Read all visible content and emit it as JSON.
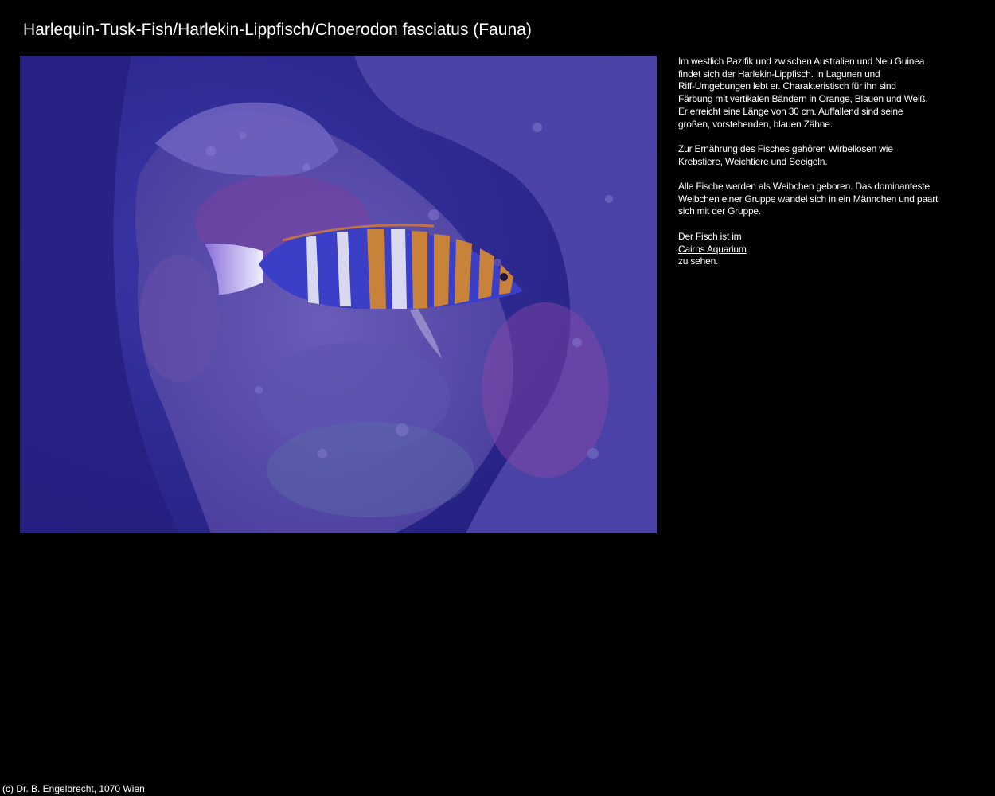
{
  "page": {
    "title": "Harlequin-Tusk-Fish/Harlekin-Lippfisch/Choerodon fasciatus (Fauna)"
  },
  "photo": {
    "subject": "fish-photo",
    "colors": {
      "water": "#2c2a8c",
      "rock": "#5a4fb0",
      "band_orange": "#c9823a",
      "band_blue": "#3b3fc8",
      "band_white": "#d8d8f0"
    }
  },
  "description": {
    "paragraph1": [
      "Im westlich Pazifik und zwischen Australien und Neu Guinea",
      "findet sich der Harlekin-Lippfisch. In Lagunen und",
      "Riff-Umgebungen lebt er. Charakteristisch für ihn sind",
      "Färbung mit vertikalen Bändern in Orange, Blauen und Weiß.",
      "Er erreicht eine Länge von 30 cm. Auffallend sind seine",
      "großen, vorstehenden, blauen Zähne."
    ],
    "paragraph2": [
      "Zur Ernährung des Fisches gehören Wirbellosen wie",
      "Krebstiere, Weichtiere und Seeigeln."
    ],
    "paragraph3": [
      "Alle Fische werden als Weibchen geboren. Das dominanteste",
      "Weibchen einer Gruppe wandel sich in ein Männchen und paart",
      "sich mit der Gruppe."
    ],
    "paragraph4": {
      "before": "Der Fisch ist im",
      "link": "Cairns Aquarium",
      "after": "zu sehen."
    }
  },
  "footer": {
    "copyright": "(c) Dr. B. Engelbrecht, 1070 Wien"
  }
}
